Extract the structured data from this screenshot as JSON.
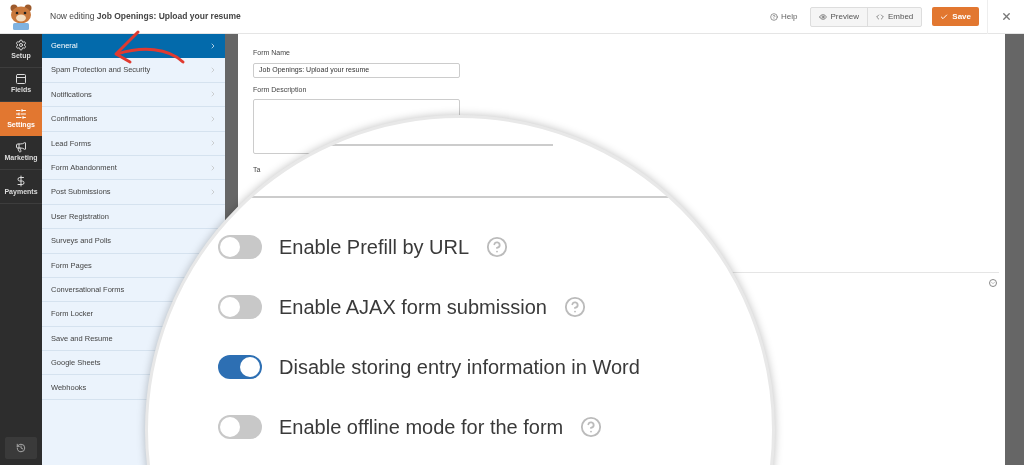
{
  "header": {
    "title": "Now editing **Job Openings: Upload your resume**",
    "help": "Help",
    "preview": "Preview",
    "embed": "Embed",
    "save": "Save"
  },
  "nav": [
    {
      "label": "Setup",
      "kind": "setup",
      "selected": false
    },
    {
      "label": "Fields",
      "kind": "fields",
      "selected": false
    },
    {
      "label": "Settings",
      "kind": "settings",
      "selected": true
    },
    {
      "label": "Marketing",
      "kind": "marketing",
      "selected": false
    },
    {
      "label": "Payments",
      "kind": "payments",
      "selected": false
    }
  ],
  "settings_menu": [
    {
      "label": "General",
      "selected": true,
      "submenu": true
    },
    {
      "label": "Spam Protection and Security",
      "selected": false,
      "submenu": true
    },
    {
      "label": "Notifications",
      "selected": false,
      "submenu": true
    },
    {
      "label": "Confirmations",
      "selected": false,
      "submenu": true
    },
    {
      "label": "Lead Forms",
      "selected": false,
      "submenu": true
    },
    {
      "label": "Form Abandonment",
      "selected": false,
      "submenu": true
    },
    {
      "label": "Post Submissions",
      "selected": false,
      "submenu": true
    },
    {
      "label": "User Registration",
      "selected": false,
      "submenu": false
    },
    {
      "label": "Surveys and Polls",
      "selected": false
    },
    {
      "label": "Form Pages",
      "selected": false
    },
    {
      "label": "Conversational Forms",
      "selected": false
    },
    {
      "label": "Form Locker",
      "selected": false
    },
    {
      "label": "Save and Resume",
      "selected": false
    },
    {
      "label": "Google Sheets",
      "selected": false
    },
    {
      "label": "Webhooks",
      "selected": false
    }
  ],
  "form": {
    "name_label": "Form Name",
    "name_value": "Job Openings: Upload your resume",
    "description_label": "Form Description",
    "tags_label": "Ta"
  },
  "magnified_toggles": [
    {
      "label": "Enable Prefill by URL",
      "on": false,
      "help": true
    },
    {
      "label": "Enable AJAX form submission",
      "on": false,
      "help": true
    },
    {
      "label": "Disable storing entry information in Word",
      "on": true,
      "help": false
    },
    {
      "label": "Enable offline mode for the form",
      "on": false,
      "help": true
    }
  ]
}
